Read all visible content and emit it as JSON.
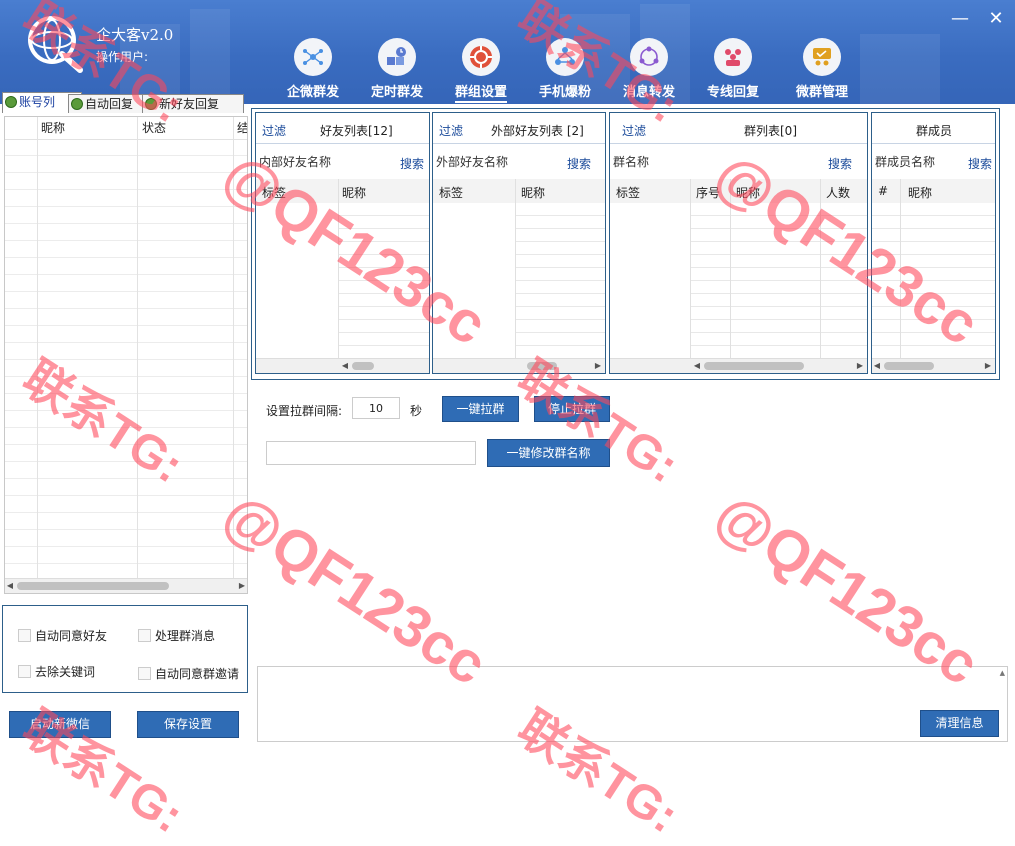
{
  "app": {
    "title": "企大客v2.0",
    "operator_label": "操作用户:"
  },
  "window": {
    "minimize": "—",
    "close": "✕"
  },
  "nav": [
    {
      "label": "企微群发",
      "icon": "network-icon",
      "color": "#4a90e2"
    },
    {
      "label": "定时群发",
      "icon": "clock-boxes-icon",
      "color": "#5a7ad0"
    },
    {
      "label": "群组设置",
      "icon": "gear-group-icon",
      "color": "#e0503a",
      "active": true
    },
    {
      "label": "手机爆粉",
      "icon": "people-triangle-icon",
      "color": "#4a90e2"
    },
    {
      "label": "消息转发",
      "icon": "cycle-users-icon",
      "color": "#8a5ad0"
    },
    {
      "label": "专线回复",
      "icon": "team-icon",
      "color": "#e04a6a"
    },
    {
      "label": "微群管理",
      "icon": "meeting-icon",
      "color": "#e0a020"
    }
  ],
  "left_tabs": [
    "账号列",
    "自动回复",
    "新好友回复"
  ],
  "left_list": {
    "col_name": "昵称",
    "col_status": "状态",
    "col_extra": "结"
  },
  "checks": {
    "auto_accept_friend": "自动同意好友",
    "handle_group_msg": "处理群消息",
    "remove_keywords": "去除关键词",
    "auto_accept_group_invite": "自动同意群邀请"
  },
  "left_buttons": {
    "start_wechat": "启动新微信",
    "save_settings": "保存设置"
  },
  "panels": {
    "friends": {
      "filter": "过滤",
      "title": "好友列表[12]",
      "sub": "内部好友名称",
      "search": "搜索",
      "col1": "标签",
      "col2": "昵称"
    },
    "external": {
      "filter": "过滤",
      "title": "外部好友列表 [2]",
      "sub": "外部好友名称",
      "search": "搜索",
      "col1": "标签",
      "col2": "昵称"
    },
    "groups": {
      "filter": "过滤",
      "title": "群列表[0]",
      "sub": "群名称",
      "search": "搜索",
      "col1": "标签",
      "col2": "序号",
      "col3": "昵称",
      "col4": "人数"
    },
    "members": {
      "title": "群成员",
      "sub": "群成员名称",
      "search": "搜索",
      "col1": "#",
      "col2": "昵称"
    }
  },
  "pull": {
    "interval_label": "设置拉群间隔:",
    "interval_value": "10",
    "unit": "秒",
    "one_click_pull": "一键拉群",
    "stop_pull": "停止拉群",
    "rename_input": "",
    "rename_all": "一键修改群名称"
  },
  "log": {
    "clear": "清理信息"
  },
  "watermark": {
    "line1": "联系TG:",
    "line2": "@QF123cc"
  }
}
